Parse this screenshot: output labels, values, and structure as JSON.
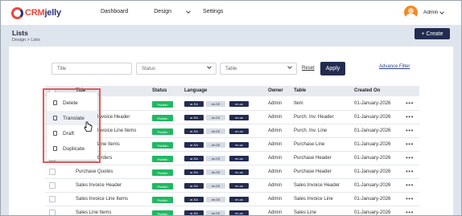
{
  "topbar": {
    "logo_prefix": "CRM",
    "logo_suffix": "jelly",
    "nav": [
      "Dashboard",
      "Design",
      "Settings"
    ],
    "user": "Admin"
  },
  "header": {
    "title": "Lists",
    "breadcrumb": [
      "Design",
      "Lists"
    ],
    "create_label": "+ Create"
  },
  "filters": {
    "title_placeholder": "Title",
    "status_placeholder": "Status",
    "table_placeholder": "Table",
    "reset_label": "Reset",
    "apply_label": "Apply",
    "advance_label": "Advance Filter"
  },
  "table": {
    "columns": [
      "Title",
      "Status",
      "Language",
      "Owner",
      "Table",
      "Created On"
    ],
    "language_codes": [
      "ar-SA",
      "de-DE",
      "en-us"
    ],
    "rows": [
      {
        "title": "Item",
        "status": "Publish",
        "owner": "Admin",
        "table": "Item",
        "created": "01-January-2026"
      },
      {
        "title": "Purchase Invoice Header",
        "status": "Publish",
        "owner": "Admin",
        "table": "Purch. Inv. Header",
        "created": "01-January-2026"
      },
      {
        "title": "Purchase Invoice Line Items",
        "status": "Publish",
        "owner": "Admin",
        "table": "Purch. Inv. Line",
        "created": "01-January-2026"
      },
      {
        "title": "Purchase Line Items",
        "status": "Publish",
        "owner": "Admin",
        "table": "Purchase Line",
        "created": "01-January-2026"
      },
      {
        "title": "Purchase Orders",
        "status": "Publish",
        "owner": "Admin",
        "table": "Purchase Header",
        "created": "01-January-2026"
      },
      {
        "title": "Purchase Quotes",
        "status": "Publish",
        "owner": "Admin",
        "table": "Purchase Header",
        "created": "01-January-2026"
      },
      {
        "title": "Sales Invoice Header",
        "status": "Publish",
        "owner": "Admin",
        "table": "Sales Invoice Header",
        "created": "01-January-2026"
      },
      {
        "title": "Sales Invoice Line Items",
        "status": "Publish",
        "owner": "Admin",
        "table": "Sales Invoice Line",
        "created": "01-January-2026"
      },
      {
        "title": "Sales Line Items",
        "status": "Publish",
        "owner": "Admin",
        "table": "Sales Line",
        "created": "01-January-2026"
      }
    ]
  },
  "context_menu": {
    "items": [
      "Delete",
      "Translate",
      "Draft",
      "Duplicate"
    ],
    "hovered": "Translate"
  },
  "colors": {
    "brand_navy": "#232c4f",
    "brand_red": "#e8473e",
    "publish_green": "#21b863",
    "highlight_red": "#e05a5a"
  }
}
